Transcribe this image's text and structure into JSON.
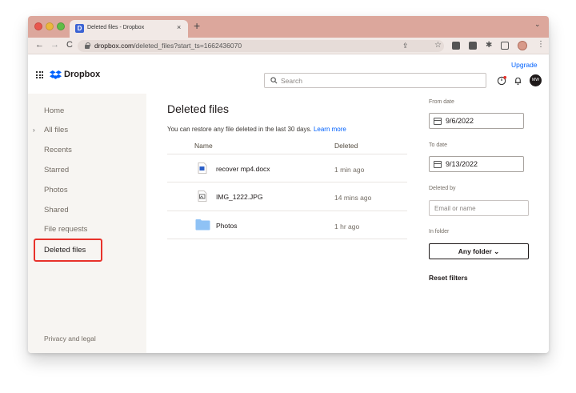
{
  "browser": {
    "tab_title": "Deleted files - Dropbox",
    "tab_favicon_letter": "D",
    "close_glyph": "×",
    "new_tab_glyph": "+",
    "tab_menu_glyph": "⌄",
    "url_host": "dropbox.com",
    "url_path": "/deleted_files?start_ts=1662436070",
    "back_glyph": "←",
    "forward_glyph": "→",
    "reload_glyph": "C",
    "share_glyph": "⇪",
    "star_glyph": "☆",
    "puzzle_glyph": "✱",
    "menu_glyph": "⋮"
  },
  "header": {
    "brand": "Dropbox",
    "upgrade": "Upgrade",
    "search_placeholder": "Search",
    "user_initials": "MW"
  },
  "sidebar": {
    "items": [
      {
        "label": "Home"
      },
      {
        "label": "All files"
      },
      {
        "label": "Recents"
      },
      {
        "label": "Starred"
      },
      {
        "label": "Photos"
      },
      {
        "label": "Shared"
      },
      {
        "label": "File requests"
      },
      {
        "label": "Deleted files"
      }
    ],
    "expand_glyph": "›",
    "footer": "Privacy and legal"
  },
  "main": {
    "title": "Deleted files",
    "restore_message": "You can restore any file deleted in the last 30 days.",
    "learn_more": "Learn more",
    "columns": {
      "name": "Name",
      "deleted": "Deleted"
    },
    "files": [
      {
        "name": "recover mp4.docx",
        "deleted": "1 min ago",
        "icon": "document-icon"
      },
      {
        "name": "IMG_1222.JPG",
        "deleted": "14 mins ago",
        "icon": "image-icon"
      },
      {
        "name": "Photos",
        "deleted": "1 hr ago",
        "icon": "folder-icon"
      }
    ]
  },
  "filters": {
    "from_label": "From date",
    "from_value": "9/6/2022",
    "to_label": "To date",
    "to_value": "9/13/2022",
    "deleted_by_label": "Deleted by",
    "deleted_by_placeholder": "Email or name",
    "in_folder_label": "In folder",
    "folder_button": "Any folder ⌄",
    "reset": "Reset filters"
  },
  "colors": {
    "accent": "#0061fe",
    "highlight_box": "#e8322b",
    "titlebar": "#dca79c",
    "sidebar_bg": "#f7f5f2",
    "folder": "#8fc2f5"
  }
}
